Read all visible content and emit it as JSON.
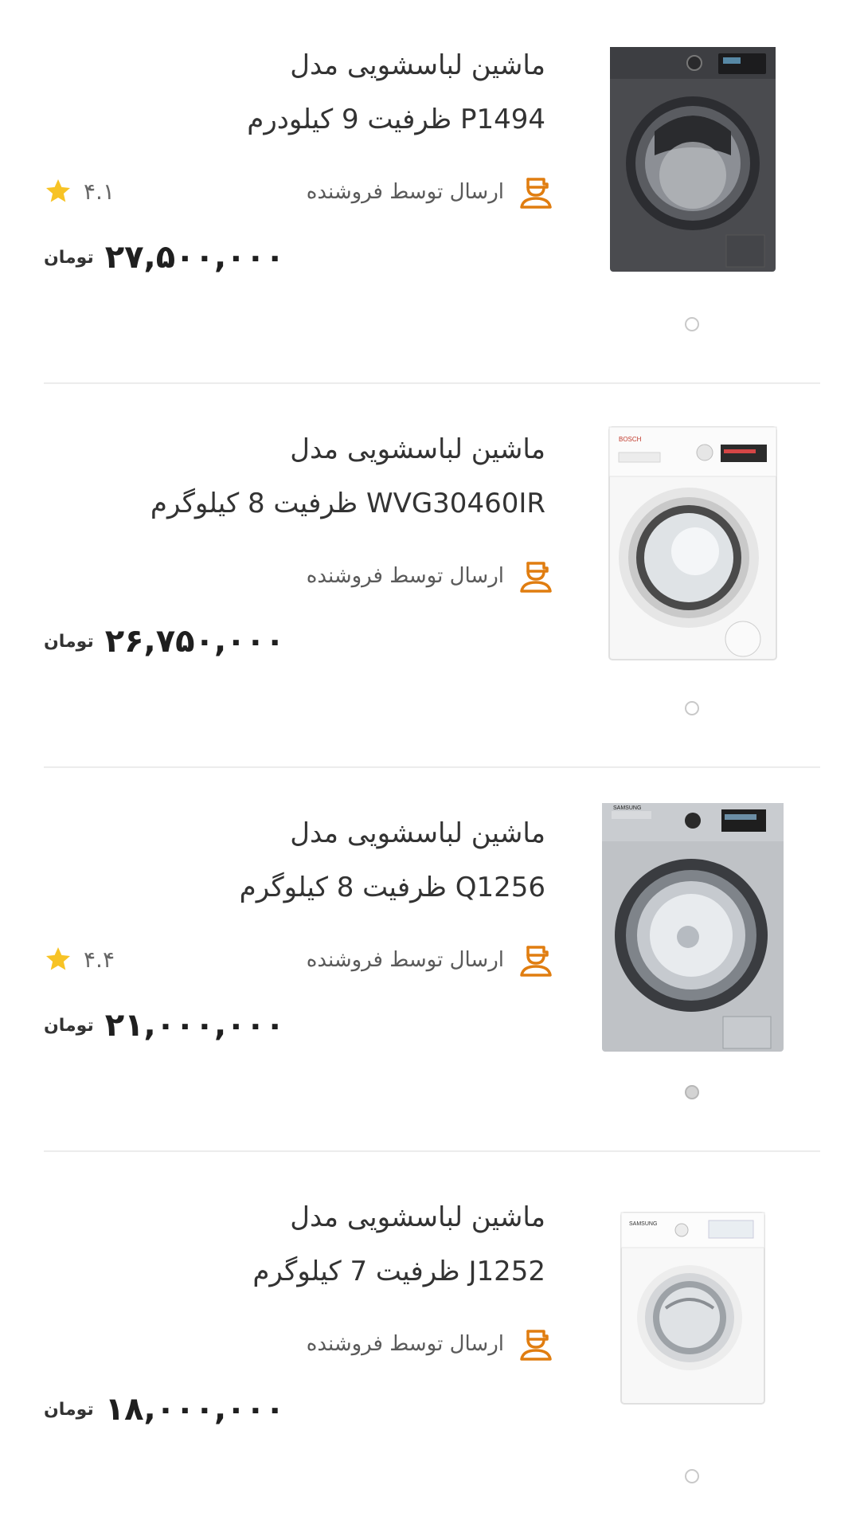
{
  "colors": {
    "accent": "#e07d10",
    "star": "#f7c325",
    "divider": "#ececec",
    "text": "#333333"
  },
  "products": [
    {
      "title_line1": "ماشین لباسشویی مدل",
      "title_line2": "P1494 ظرفیت 9 کیلودرم",
      "seller": "ارسال توسط فروشنده",
      "rating": "۴.۱",
      "price": "۲۷,۵۰۰,۰۰۰",
      "currency": "تومان",
      "image": "washing-machine-dark",
      "carousel_dot_active": false
    },
    {
      "title_line1": "ماشین لباسشویی مدل",
      "title_line2": "WVG30460IR ظرفیت 8 کیلوگرم",
      "seller": "ارسال توسط فروشنده",
      "rating": "",
      "price": "۲۶,۷۵۰,۰۰۰",
      "currency": "تومان",
      "image": "washing-machine-white",
      "carousel_dot_active": false
    },
    {
      "title_line1": "ماشین لباسشویی مدل",
      "title_line2": "Q1256 ظرفیت 8 کیلوگرم",
      "seller": "ارسال توسط فروشنده",
      "rating": "۴.۴",
      "price": "۲۱,۰۰۰,۰۰۰",
      "currency": "تومان",
      "image": "washing-machine-silver",
      "carousel_dot_active": true
    },
    {
      "title_line1": "ماشین لباسشویی مدل",
      "title_line2": "J1252 ظرفیت 7 کیلوگرم",
      "seller": "ارسال توسط فروشنده",
      "rating": "",
      "price": "۱۸,۰۰۰,۰۰۰",
      "currency": "تومان",
      "image": "washing-machine-white",
      "carousel_dot_active": false
    }
  ]
}
